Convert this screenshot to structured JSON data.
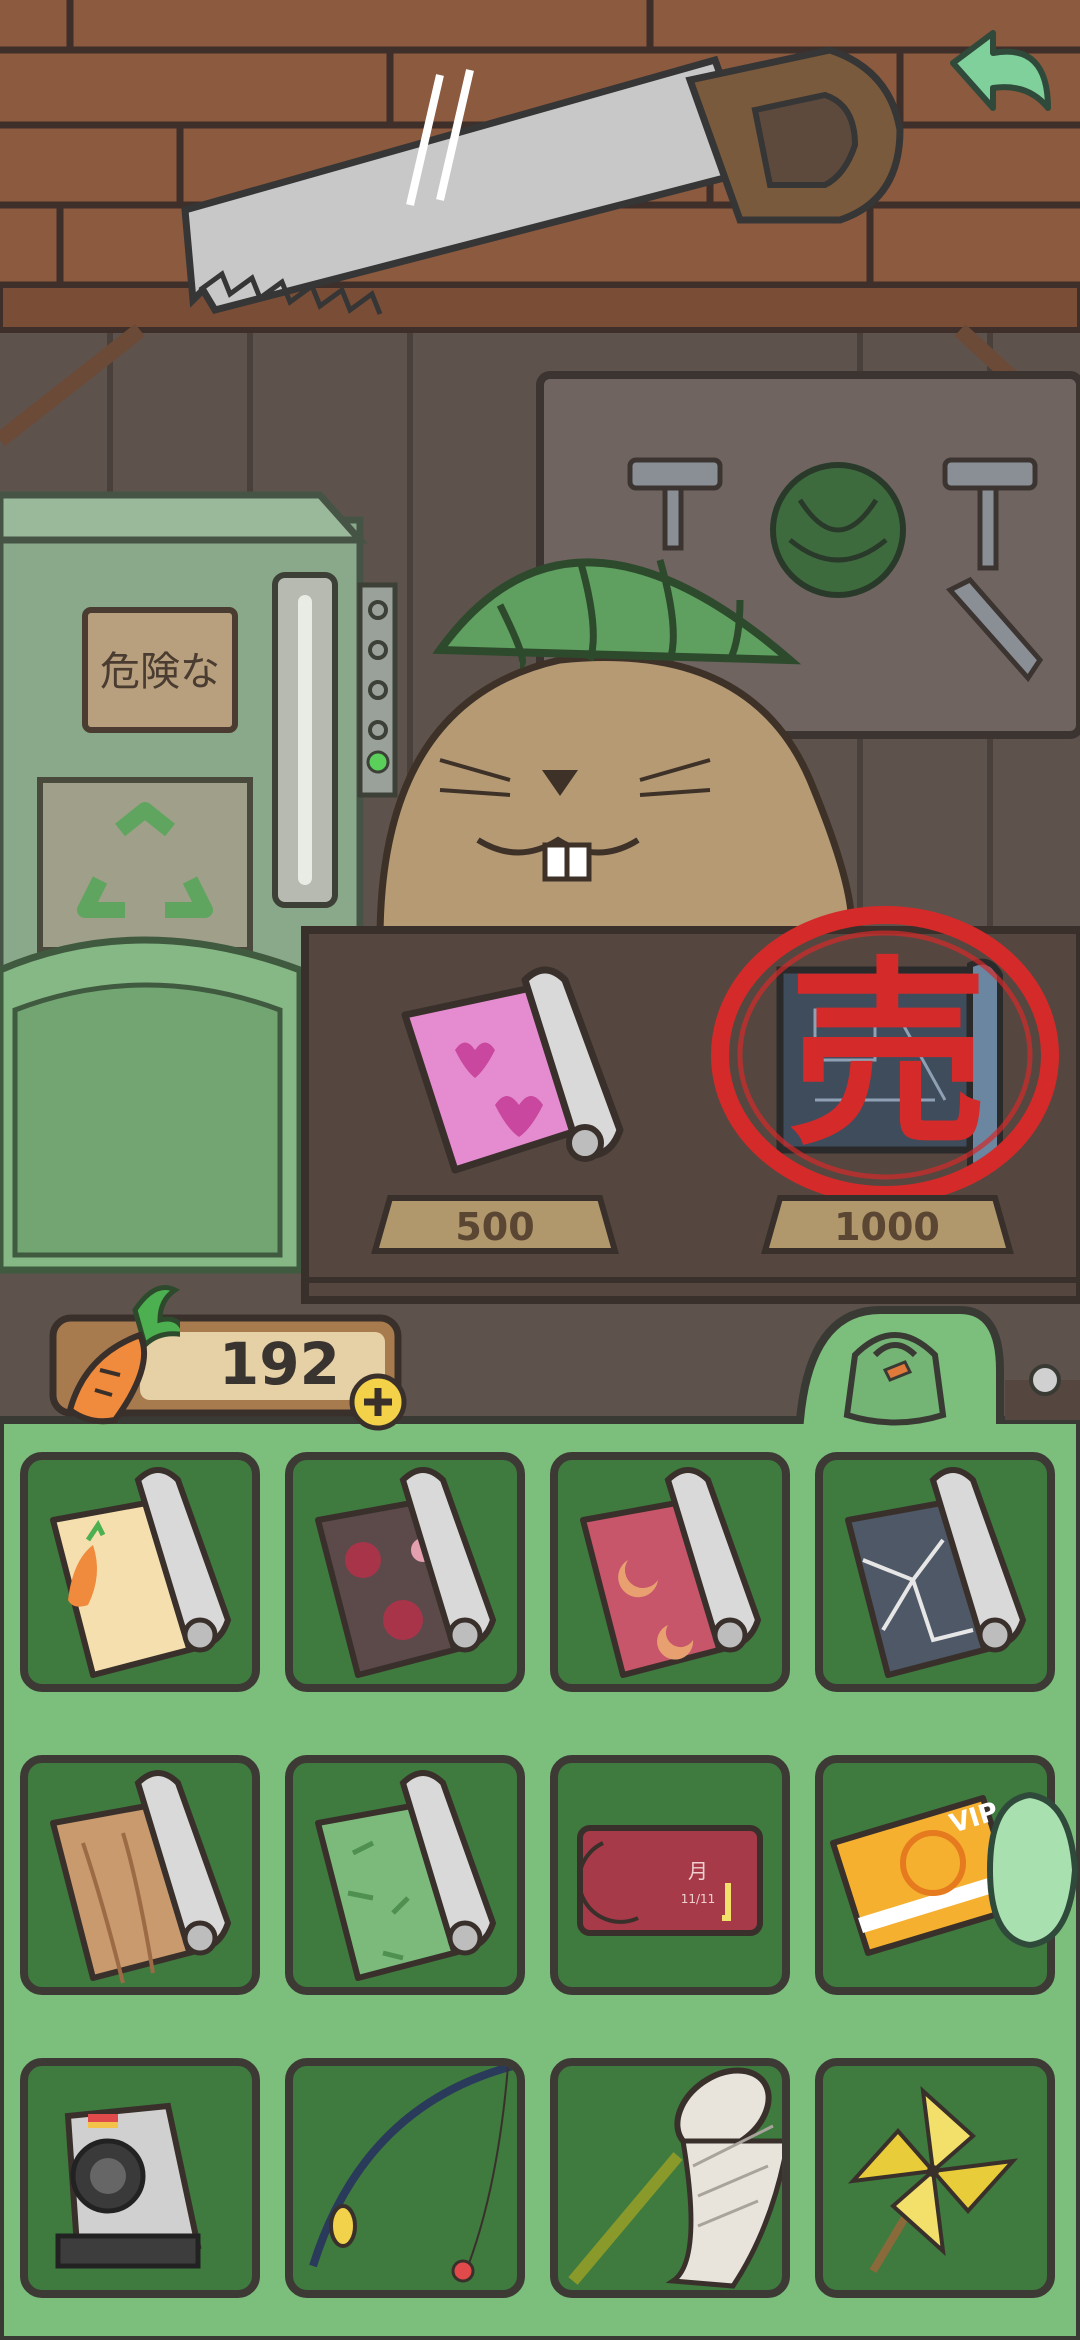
{
  "shop": {
    "sign_text": "危険な",
    "items": [
      {
        "name": "pink-heart-wallpaper",
        "price": "500",
        "sold": false
      },
      {
        "name": "blueprint-wallpaper",
        "price": "1000",
        "sold": true,
        "sold_stamp": "売"
      }
    ]
  },
  "carrots": {
    "count": "192"
  },
  "inventory": {
    "slots": [
      {
        "name": "carrot-wallpaper-roll"
      },
      {
        "name": "sakura-wallpaper-roll"
      },
      {
        "name": "moon-wallpaper-roll"
      },
      {
        "name": "cracked-stone-wallpaper-roll"
      },
      {
        "name": "wood-wallpaper-roll"
      },
      {
        "name": "bamboo-wallpaper-roll"
      },
      {
        "name": "calendar-ticket",
        "text": "月",
        "date": "11/11"
      },
      {
        "name": "vip-card",
        "text": "VIP"
      },
      {
        "name": "camera"
      },
      {
        "name": "fishing-rod"
      },
      {
        "name": "bug-net"
      },
      {
        "name": "pinwheel"
      }
    ]
  },
  "colors": {
    "panel_green": "#7cbf7c",
    "slot_green": "#3f7a3f",
    "sold_red": "#d42a2a",
    "wood": "#8b5a3c"
  }
}
